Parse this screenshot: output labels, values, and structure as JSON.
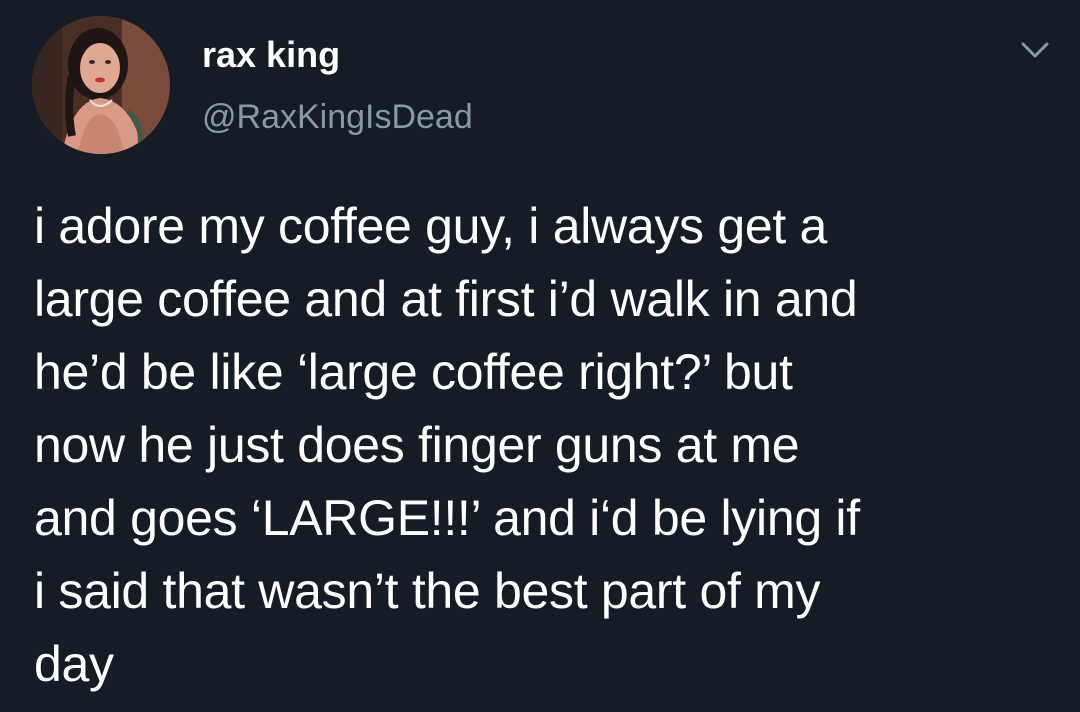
{
  "colors": {
    "background": "#151c26",
    "text": "#ffffff",
    "secondary": "#8899a6"
  },
  "author": {
    "display_name": "rax king",
    "handle": "@RaxKingIsDead",
    "avatar_icon": "avatar-photo"
  },
  "menu": {
    "icon": "chevron-down-icon"
  },
  "tweet": {
    "text": "i adore my coffee guy, i always get a\nlarge coffee and at first i’d walk in and\nhe’d be like ‘large coffee right?’ but\nnow he just does finger guns at me\nand goes ‘LARGE!!!’ and i‘d be lying if\ni said that wasn’t the best part of my\nday"
  }
}
